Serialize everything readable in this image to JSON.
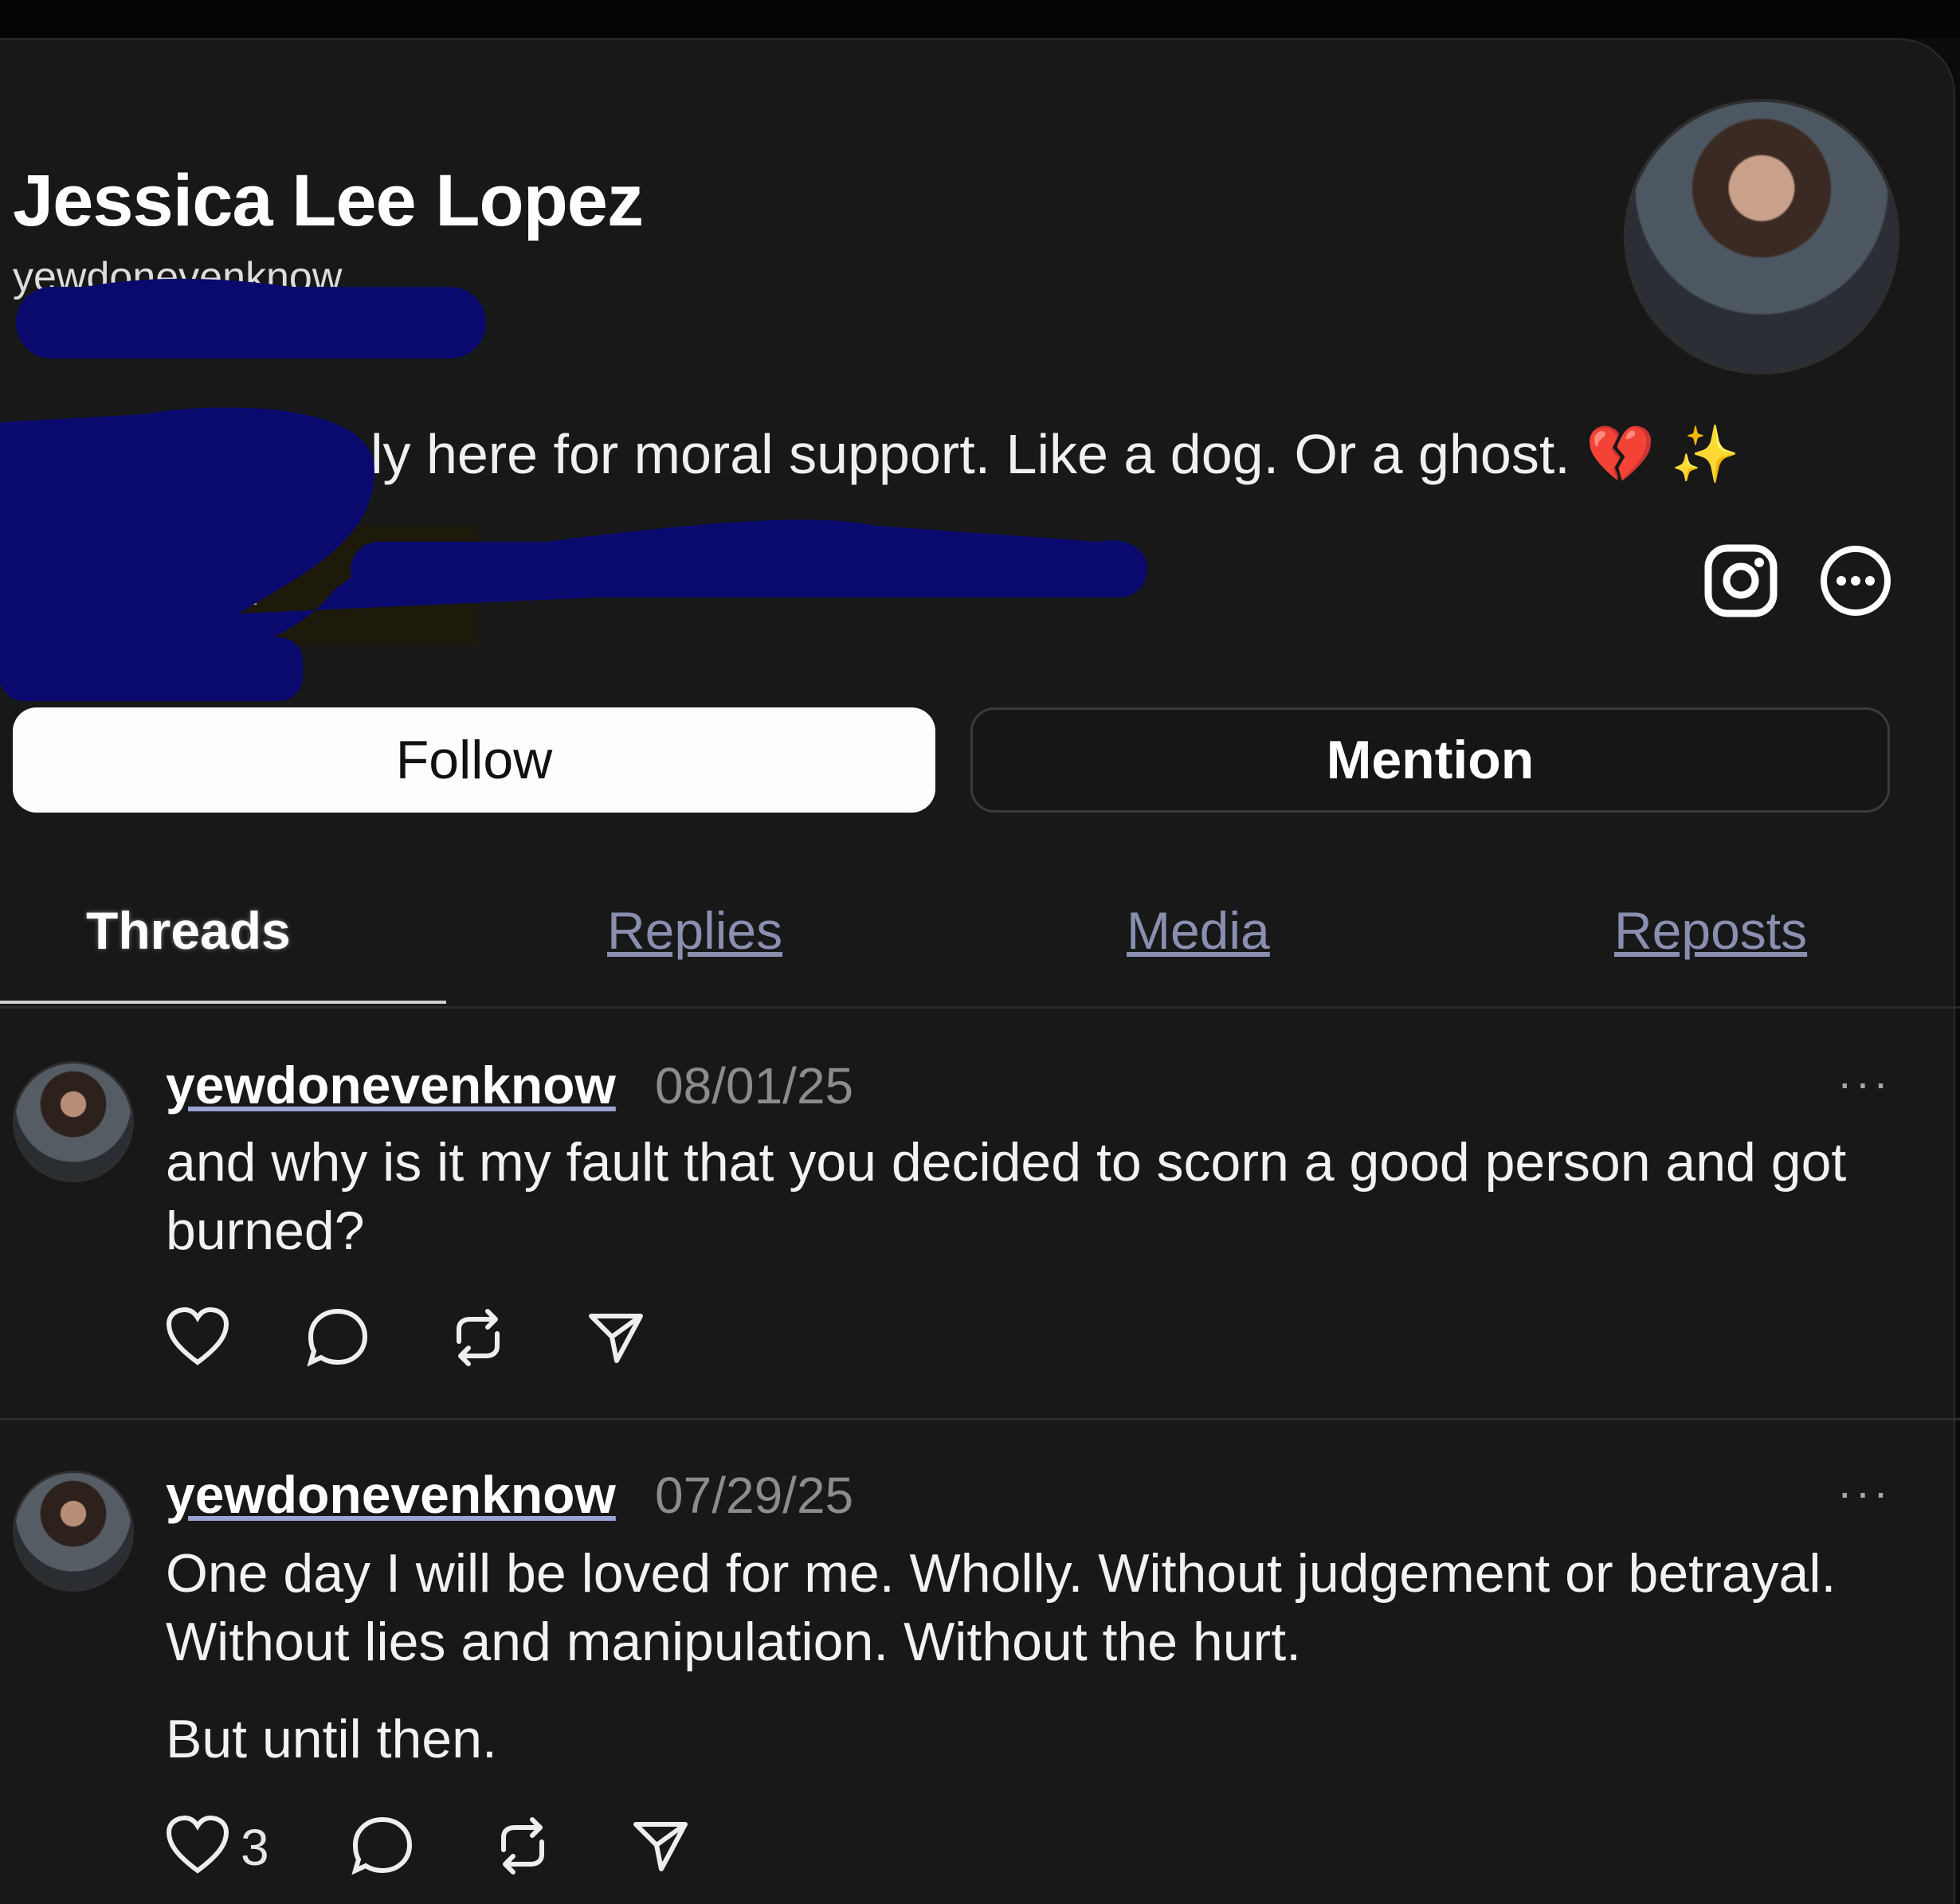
{
  "profile": {
    "name": "Jessica Lee Lopez",
    "handle": "yewdonevenknow",
    "bio": "Here. I'm simply here for moral support. Like a dog. Or a ghost. 💔 ✨",
    "followers": "0 followers",
    "instagram_icon": "instagram-icon",
    "more_icon": "more-circle-icon"
  },
  "actions": {
    "follow": "Follow",
    "mention": "Mention"
  },
  "tabs": [
    {
      "label": "Threads",
      "active": true
    },
    {
      "label": "Replies",
      "active": false
    },
    {
      "label": "Media",
      "active": false
    },
    {
      "label": "Reposts",
      "active": false
    }
  ],
  "posts": [
    {
      "username": "yewdonevenknow",
      "date": "08/01/25",
      "more": "···",
      "text": "and why is it my fault that you decided to scorn a good person and got burned?",
      "likes": ""
    },
    {
      "username": "yewdonevenknow",
      "date": "07/29/25",
      "more": "···",
      "text": "One day I will be loved for me. Wholly. Without judgement or betrayal. Without lies and manipulation. Without the hurt.",
      "text2": "But until then.",
      "likes": "3"
    }
  ],
  "colors": {
    "background": "#181819",
    "redaction": "#0a0a6e",
    "follow_button": "#fdfdfd"
  }
}
